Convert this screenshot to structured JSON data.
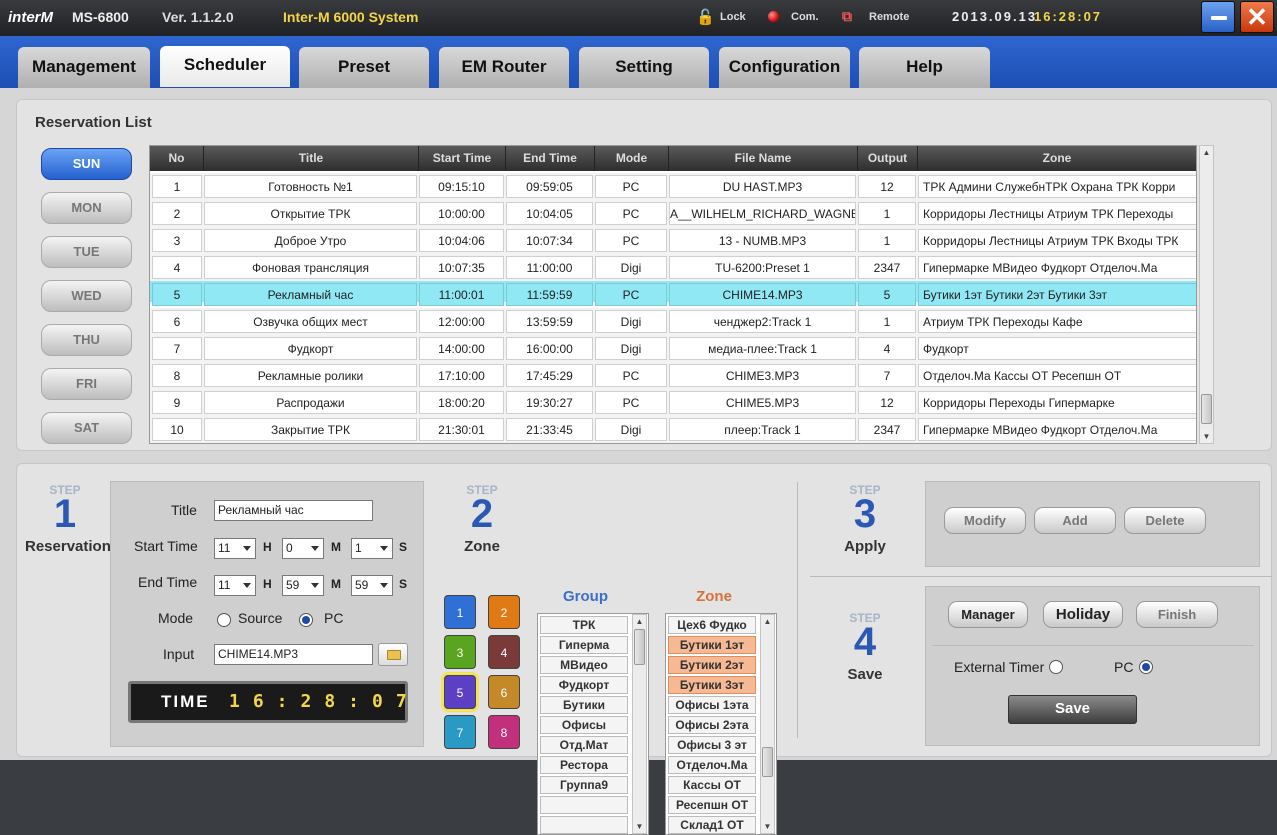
{
  "titlebar": {
    "logo": "interM",
    "model": "MS-6800",
    "version": "Ver. 1.1.2.0",
    "system": "Inter-M 6000 System",
    "lock": "Lock",
    "com": "Com.",
    "remote": "Remote",
    "date": "2013.09.13",
    "time": "16:28:07",
    "close_glyph": "✕"
  },
  "tabs": [
    "Management",
    "Scheduler",
    "Preset",
    "EM Router",
    "Setting",
    "Configuration",
    "Help"
  ],
  "active_tab": "Scheduler",
  "reservation": {
    "title": "Reservation List",
    "days": [
      "SUN",
      "MON",
      "TUE",
      "WED",
      "THU",
      "FRI",
      "SAT"
    ],
    "active_day": "SUN",
    "columns": [
      "No",
      "Title",
      "Start Time",
      "End Time",
      "Mode",
      "File Name",
      "Output",
      "Zone"
    ],
    "rows": [
      [
        "1",
        "Готовность №1",
        "09:15:10",
        "09:59:05",
        "PC",
        "DU HAST.MP3",
        "12",
        "ТРК Админи СлужебнТРК Охрана ТРК Корри"
      ],
      [
        "2",
        "Открытие ТРК",
        "10:00:00",
        "10:04:05",
        "PC",
        "A__WILHELM_RICHARD_WAGNE",
        "1",
        "Корридоры Лестницы Атриум ТРК Переходы"
      ],
      [
        "3",
        "Доброе Утро",
        "10:04:06",
        "10:07:34",
        "PC",
        "13 - NUMB.MP3",
        "1",
        "Корридоры Лестницы Атриум ТРК Входы ТРК"
      ],
      [
        "4",
        "Фоновая трансляция",
        "10:07:35",
        "11:00:00",
        "Digi",
        "TU-6200:Preset 1",
        "2347",
        "Гипермарке МВидео Фудкорт Отделоч.Ма"
      ],
      [
        "5",
        "Рекламный час",
        "11:00:01",
        "11:59:59",
        "PC",
        "CHIME14.MP3",
        "5",
        "Бутики 1эт Бутики 2эт Бутики 3эт"
      ],
      [
        "6",
        "Озвучка общих мест",
        "12:00:00",
        "13:59:59",
        "Digi",
        "ченджер2:Track 1",
        "1",
        "Атриум ТРК Переходы Кафе"
      ],
      [
        "7",
        "Фудкорт",
        "14:00:00",
        "16:00:00",
        "Digi",
        "медиа-плее:Track 1",
        "4",
        "Фудкорт"
      ],
      [
        "8",
        "Рекламные ролики",
        "17:10:00",
        "17:45:29",
        "PC",
        "CHIME3.MP3",
        "7",
        "Отделоч.Ма Кассы ОТ Ресепшн ОТ"
      ],
      [
        "9",
        "Распродажи",
        "18:00:20",
        "19:30:27",
        "PC",
        "CHIME5.MP3",
        "12",
        "Корридоры Переходы Гипермарке"
      ],
      [
        "10",
        "Закрытие ТРК",
        "21:30:01",
        "21:33:45",
        "Digi",
        "плеер:Track 1",
        "2347",
        "Гипермарке МВидео Фудкорт Отделоч.Ма"
      ]
    ],
    "selected_row": 5
  },
  "step1": {
    "step_word": "STEP",
    "number": "1",
    "label": "Reservation",
    "title_label": "Title",
    "title_value": "Рекламный час",
    "start_label": "Start Time",
    "start_h": "11",
    "start_m": "0",
    "start_s": "1",
    "end_label": "End Time",
    "end_h": "11",
    "end_m": "59",
    "end_s": "59",
    "h": "H",
    "m": "M",
    "s": "S",
    "mode_label": "Mode",
    "mode_source": "Source",
    "mode_pc": "PC",
    "mode_selected": "PC",
    "input_label": "Input",
    "input_value": "CHIME14.MP3",
    "time_label": "TIME",
    "time_value": "16:28:07"
  },
  "step2": {
    "step_word": "STEP",
    "number": "2",
    "label": "Zone",
    "zone_buttons": [
      {
        "label": "1",
        "color": "#2f6fd6"
      },
      {
        "label": "2",
        "color": "#e07a14"
      },
      {
        "label": "3",
        "color": "#5aa51f"
      },
      {
        "label": "4",
        "color": "#7a3a3a"
      },
      {
        "label": "5",
        "color": "#5b3fc4"
      },
      {
        "label": "6",
        "color": "#c48a2a"
      },
      {
        "label": "7",
        "color": "#2a9ac4"
      },
      {
        "label": "8",
        "color": "#c22f7a"
      }
    ],
    "selected_zone_button": "5",
    "group_title": "Group",
    "zone_title": "Zone",
    "groups": [
      "ТРК",
      "Гиперма",
      "МВидео",
      "Фудкорт",
      "Бутики",
      "Офисы",
      "Отд.Мат",
      "Рестора",
      "Группа9",
      "",
      ""
    ],
    "zones": [
      "Цех6 Фудко",
      "Бутики 1эт",
      "Бутики 2эт",
      "Бутики 3эт",
      "Офисы 1эта",
      "Офисы 2эта",
      "Офисы 3 эт",
      "Отделоч.Ма",
      "Кассы ОТ",
      "Ресепшн ОТ",
      "Склад1 ОТ"
    ],
    "highlighted_zones": [
      "Бутики 1эт",
      "Бутики 2эт",
      "Бутики 3эт"
    ]
  },
  "step3": {
    "step_word": "STEP",
    "number": "3",
    "label": "Apply",
    "modify": "Modify",
    "add": "Add",
    "delete": "Delete"
  },
  "step4": {
    "step_word": "STEP",
    "number": "4",
    "label": "Save",
    "manager": "Manager",
    "holiday": "Holiday",
    "finish": "Finish",
    "external_timer": "External Timer",
    "pc": "PC",
    "timer_selected": "PC",
    "save": "Save"
  }
}
